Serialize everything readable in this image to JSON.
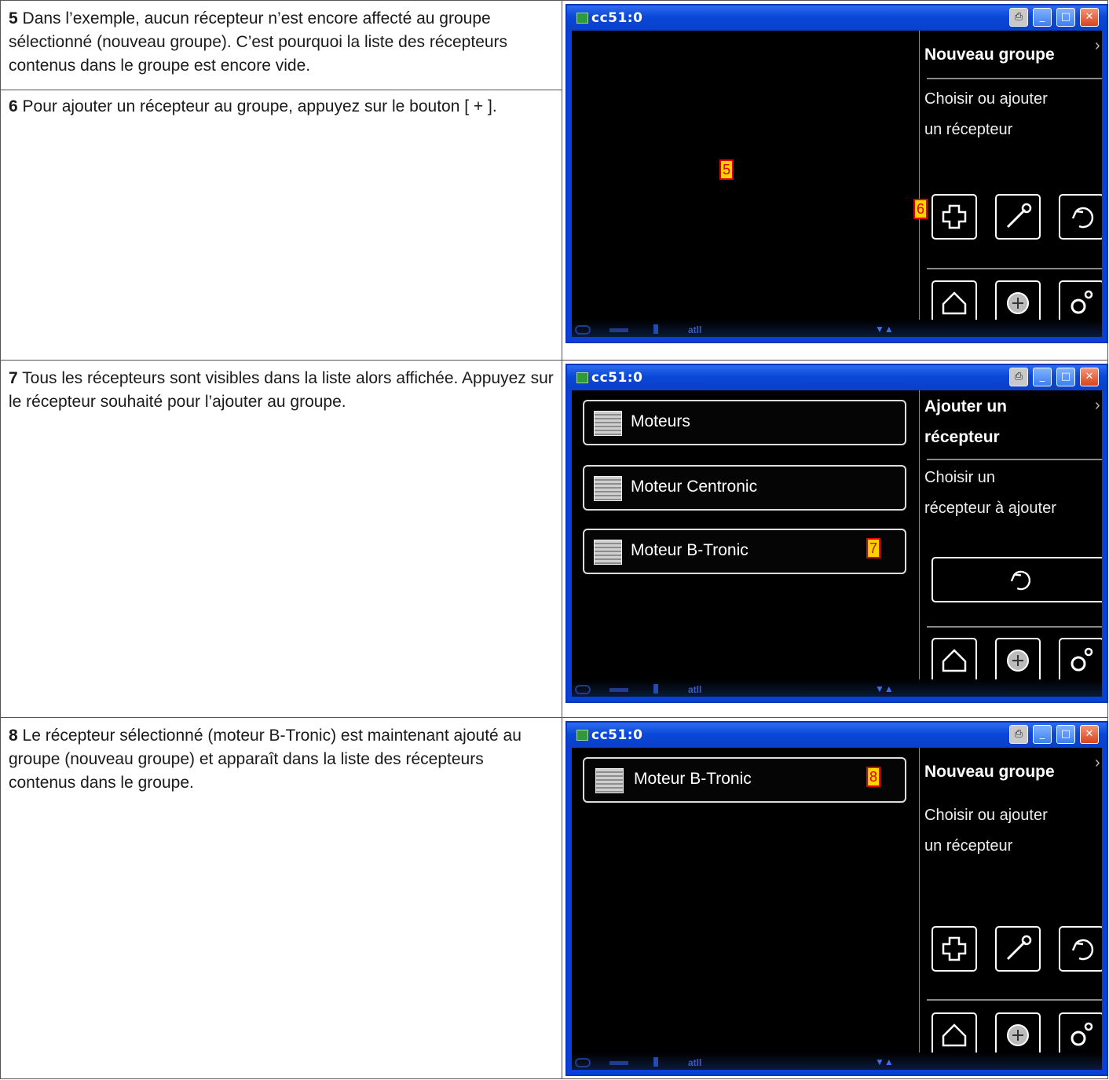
{
  "steps": [
    {
      "num": "5",
      "text": " Dans l’exemple, aucun récepteur n’est encore affecté au groupe sélectionné (nouveau groupe). C’est pourquoi la liste des récepteurs contenus dans le groupe est encore vide."
    },
    {
      "num": "6",
      "text": " Pour ajouter un récepteur au groupe, appuyez sur le bouton [ + ]."
    },
    {
      "num": "7",
      "text": " Tous les récepteurs sont visibles dans la liste alors affichée. Appuyez sur le récepteur souhaité pour l’ajouter au groupe."
    },
    {
      "num": "8",
      "text": " Le récepteur sélectionné (moteur B-Tronic) est maintenant ajouté au groupe (nouveau groupe) et apparaît dans la liste des récepteurs contenus dans le groupe."
    }
  ],
  "window_title": "cc51:0",
  "screen1": {
    "panel_title": "Nouveau groupe",
    "sub_line1": "Choisir ou ajouter",
    "sub_line2": "un récepteur",
    "marker_a": "5",
    "marker_b": "6"
  },
  "screen2": {
    "panel_title_line1": "Ajouter un",
    "panel_title_line2": "récepteur",
    "sub_line1": "Choisir un",
    "sub_line2": "récepteur à ajouter",
    "items": [
      "Moteurs",
      "Moteur Centronic",
      "Moteur B-Tronic"
    ],
    "marker": "7"
  },
  "screen3": {
    "panel_title": "Nouveau groupe",
    "sub_line1": "Choisir ou ajouter",
    "sub_line2": "un récepteur",
    "items": [
      "Moteur B-Tronic"
    ],
    "marker": "8"
  },
  "status_signal": "atll"
}
